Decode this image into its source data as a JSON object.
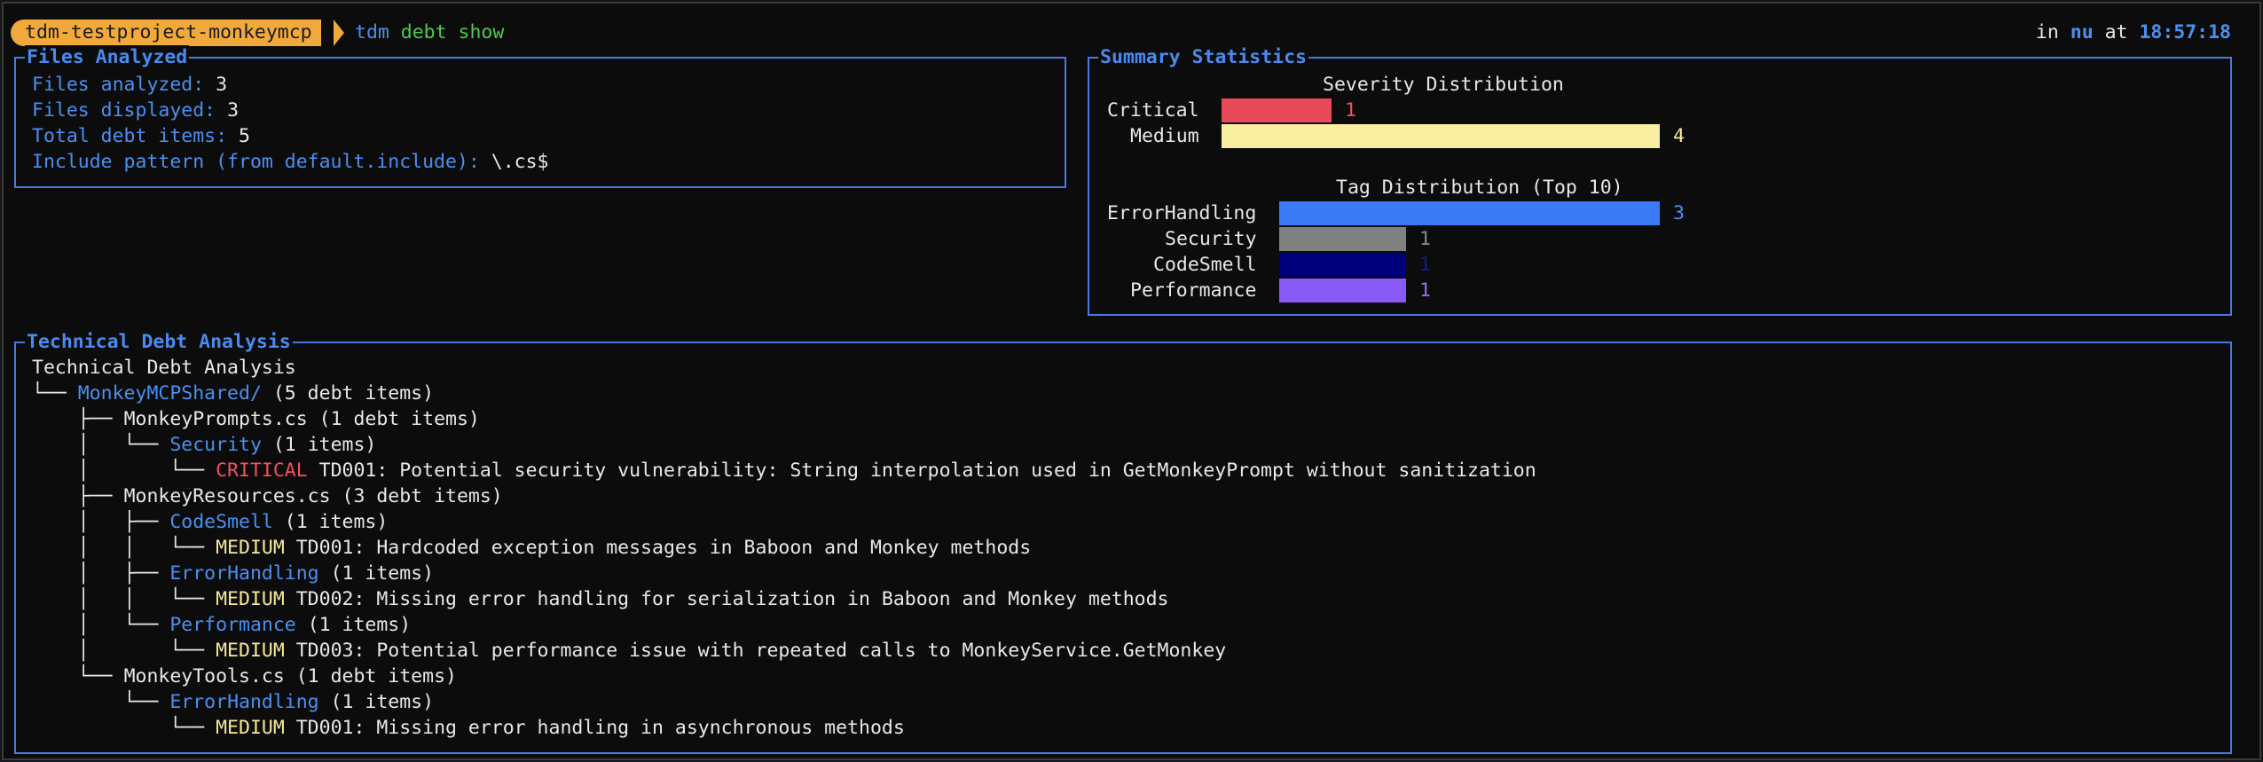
{
  "prompt": {
    "project": "tdm-testproject-monkeymcp",
    "command": "tdm",
    "args": "debt show",
    "right_in": "in",
    "right_host": "nu",
    "right_at": "at",
    "right_time": "18:57:18"
  },
  "files_panel": {
    "title": "Files Analyzed",
    "rows": [
      {
        "label": "Files analyzed:",
        "value": "3"
      },
      {
        "label": "Files displayed:",
        "value": "3"
      },
      {
        "label": "Total debt items:",
        "value": "5"
      },
      {
        "label": "Include pattern (from default.include):",
        "value": "\\.cs$"
      }
    ]
  },
  "summary_panel": {
    "title": "Summary Statistics",
    "severity_title": "Severity Distribution",
    "tag_title": "Tag Distribution (Top 10)"
  },
  "chart_data": [
    {
      "type": "bar",
      "title": "Severity Distribution",
      "categories": [
        "Critical",
        "Medium"
      ],
      "values": [
        1,
        4
      ],
      "colors": [
        "#e84a5a",
        "#f8f0a0"
      ]
    },
    {
      "type": "bar",
      "title": "Tag Distribution (Top 10)",
      "categories": [
        "ErrorHandling",
        "Security",
        "CodeSmell",
        "Performance"
      ],
      "values": [
        3,
        1,
        1,
        1
      ],
      "colors": [
        "#3a7af5",
        "#808080",
        "#00007a",
        "#8a5af8"
      ]
    }
  ],
  "debt_panel": {
    "title": "Technical Debt Analysis",
    "tree_title": "Technical Debt Analysis",
    "folder": {
      "name": "MonkeyMCPShared/",
      "count": "(5 debt items)"
    },
    "files": [
      {
        "name": "MonkeyPrompts.cs",
        "count": "(1 debt items)",
        "tags": [
          {
            "name": "Security",
            "count": "(1 items)",
            "items": [
              {
                "severity": "CRITICAL",
                "text": "TD001: Potential security vulnerability: String interpolation used in GetMonkeyPrompt without sanitization"
              }
            ]
          }
        ]
      },
      {
        "name": "MonkeyResources.cs",
        "count": "(3 debt items)",
        "tags": [
          {
            "name": "CodeSmell",
            "count": "(1 items)",
            "items": [
              {
                "severity": "MEDIUM",
                "text": "TD001: Hardcoded exception messages in Baboon and Monkey methods"
              }
            ]
          },
          {
            "name": "ErrorHandling",
            "count": "(1 items)",
            "items": [
              {
                "severity": "MEDIUM",
                "text": "TD002: Missing error handling for serialization in Baboon and Monkey methods"
              }
            ]
          },
          {
            "name": "Performance",
            "count": "(1 items)",
            "items": [
              {
                "severity": "MEDIUM",
                "text": "TD003: Potential performance issue with repeated calls to MonkeyService.GetMonkey"
              }
            ]
          }
        ]
      },
      {
        "name": "MonkeyTools.cs",
        "count": "(1 debt items)",
        "tags": [
          {
            "name": "ErrorHandling",
            "count": "(1 items)",
            "items": [
              {
                "severity": "MEDIUM",
                "text": "TD001: Missing error handling in asynchronous methods"
              }
            ]
          }
        ]
      }
    ]
  }
}
